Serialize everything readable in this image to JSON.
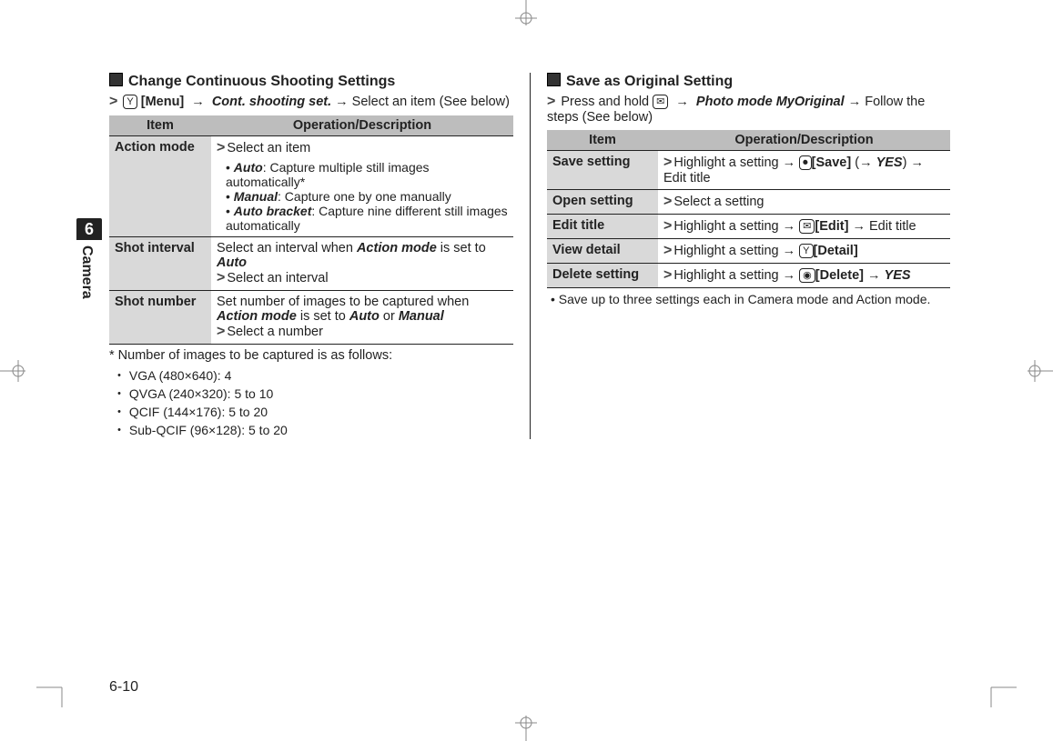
{
  "tab": {
    "number": "6",
    "label": "Camera"
  },
  "pageNumber": "6-10",
  "left": {
    "heading": "Change Continuous Shooting Settings",
    "intro": {
      "chev": ">",
      "key": "Y",
      "keyLabel": "[Menu]",
      "arrow": "→",
      "option": "Cont. shooting set.",
      "tail": " →  Select an item (See below)"
    },
    "headers": {
      "item": "Item",
      "desc": "Operation/Description"
    },
    "rows": {
      "r0": {
        "item": "Action mode",
        "lead": "Select an item",
        "b1a": "Auto",
        "b1b": ": Capture multiple still images automatically*",
        "b2a": "Manual",
        "b2b": ": Capture one by one manually",
        "b3a": "Auto bracket",
        "b3b": ": Capture nine different still images automatically"
      },
      "r1": {
        "item": "Shot interval",
        "l1a": "Select an interval when ",
        "l1b": "Action mode",
        "l1c": " is set to ",
        "l1d": "Auto",
        "l2": "Select an interval"
      },
      "r2": {
        "item": "Shot number",
        "l1a": "Set number of images to be captured when ",
        "l1b": "Action mode",
        "l1c": " is set to ",
        "l1d": "Auto",
        "l1e": " or ",
        "l1f": "Manual",
        "l2": "Select a number"
      }
    },
    "footnote": {
      "lead": "* Number of images to be captured is as follows:",
      "i1": "VGA (480×640): 4",
      "i2": "QVGA (240×320): 5 to 10",
      "i3": "QCIF (144×176): 5 to 20",
      "i4": "Sub-QCIF (96×128): 5 to 20"
    }
  },
  "right": {
    "heading": "Save as Original Setting",
    "intro": {
      "chev": ">",
      "lead": "Press and hold ",
      "key": "✉",
      "arrow": "→",
      "option": "Photo mode MyOriginal",
      "tail": " → Follow the steps (See below)"
    },
    "headers": {
      "item": "Item",
      "desc": "Operation/Description"
    },
    "rows": {
      "r0": {
        "item": "Save setting",
        "a": "Highlight a setting → ",
        "key": "⏺",
        "klabel": "[Save]",
        "paren": "(→ ",
        "yes": "YES",
        "b": ") → Edit title"
      },
      "r1": {
        "item": "Open setting",
        "a": "Select a setting"
      },
      "r2": {
        "item": "Edit title",
        "a": "Highlight a setting → ",
        "key": "✉",
        "klabel": "[Edit]",
        "b": " → Edit title"
      },
      "r3": {
        "item": "View detail",
        "a": "Highlight a setting → ",
        "key": "Y",
        "klabel": "[Detail]"
      },
      "r4": {
        "item": "Delete setting",
        "a": "Highlight a setting → ",
        "key": "◉",
        "klabel": "[Delete]",
        "b": " → ",
        "yes": "YES"
      }
    },
    "note": "Save up to three settings each in Camera mode and Action mode."
  }
}
